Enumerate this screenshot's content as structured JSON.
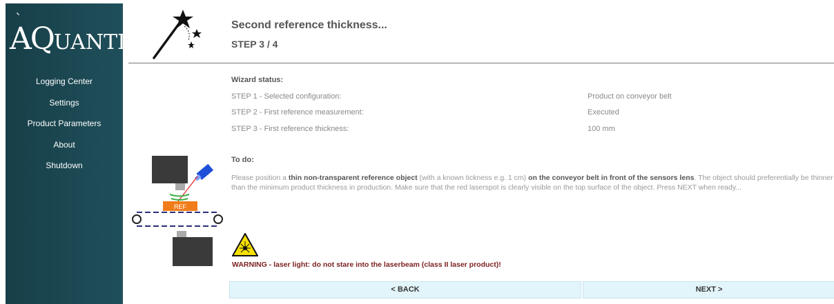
{
  "brand": {
    "logo_main": "AQ",
    "logo_rest": "UANTIS",
    "logo_accent": "`"
  },
  "nav": {
    "items": [
      {
        "label": "Logging Center"
      },
      {
        "label": "Settings"
      },
      {
        "label": "Product Parameters"
      },
      {
        "label": "About"
      },
      {
        "label": "Shutdown"
      }
    ]
  },
  "header": {
    "title": "Second reference thickness...",
    "step": "STEP 3 / 4"
  },
  "status": {
    "heading": "Wizard status:",
    "rows": [
      {
        "label": "STEP 1 - Selected configuration:",
        "value": "Product on conveyor belt"
      },
      {
        "label": "STEP 2 - First reference measurement:",
        "value": "Executed"
      },
      {
        "label": "STEP 3 - First reference thickness:",
        "value": "100 mm"
      }
    ]
  },
  "todo": {
    "heading": "To do:",
    "p1": "Please position a ",
    "b1": "thin non-transparent reference object",
    "p2": " (with a known tickness e.g. 1 cm) ",
    "b2": "on the conveyor belt in front of the sensors lens",
    "p3": ". The object should preferentially be thinner than the minimum product thickness in production. Make sure that the red laserspot is clearly visible on the top surface of the object. Press NEXT when ready..."
  },
  "illustration": {
    "ref_label": "REF"
  },
  "warning": {
    "text": "WARNING - laser light: do not stare into the laserbeam (class II laser product)!"
  },
  "buttons": {
    "back": "< BACK",
    "next": "NEXT >"
  },
  "colors": {
    "sidebar": "#1c4a55",
    "button_bg": "#e2f5fb",
    "warning": "#7a1f1f",
    "ref": "#f07d1a",
    "belt": "#2a2d7a"
  }
}
